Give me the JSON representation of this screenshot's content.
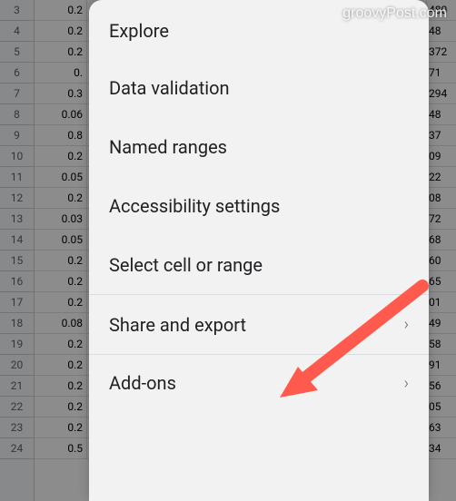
{
  "watermark": "groovyPost.com",
  "spreadsheet": {
    "row_numbers": [
      "3",
      "4",
      "5",
      "6",
      "7",
      "8",
      "9",
      "10",
      "11",
      "12",
      "13",
      "14",
      "15",
      "16",
      "17",
      "18",
      "19",
      "20",
      "21",
      "22",
      "23",
      "24"
    ],
    "col_a_values": [
      "0.2",
      "0.2",
      "0.2",
      "0.",
      "0.3",
      "0.06",
      "0.8",
      "0.2",
      "0.05",
      "0.2",
      "0.03",
      "0.05",
      "0.2",
      "0.2",
      "0.2",
      "0.08",
      "0.2",
      "0.2",
      "0.2",
      "0.2",
      "0.2",
      "0.5"
    ],
    "col_c_values": [
      "480",
      "48",
      "372",
      "71",
      "294",
      "48",
      "37",
      "09",
      "22",
      "08",
      "72",
      "68",
      "60",
      "65",
      "01",
      "49",
      "58",
      "91",
      "56",
      "05",
      "63",
      "34"
    ]
  },
  "menu": {
    "items": [
      {
        "label": "Explore",
        "has_chevron": false
      },
      {
        "label": "Data validation",
        "has_chevron": false
      },
      {
        "label": "Named ranges",
        "has_chevron": false
      },
      {
        "label": "Accessibility settings",
        "has_chevron": false
      },
      {
        "label": "Select cell or range",
        "has_chevron": false
      },
      {
        "label": "Share and export",
        "has_chevron": true
      },
      {
        "label": "Add-ons",
        "has_chevron": true
      }
    ]
  },
  "arrow": {
    "color": "#ff5a4d"
  }
}
